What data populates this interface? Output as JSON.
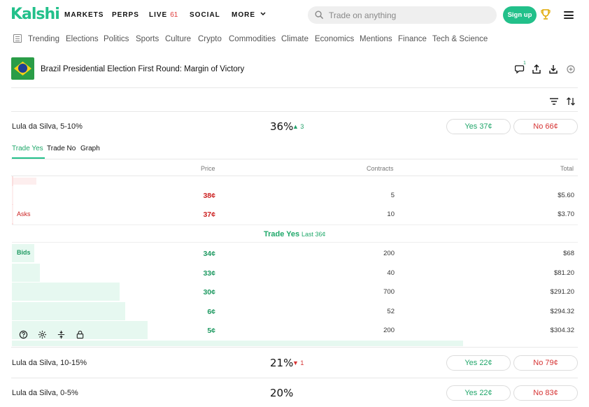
{
  "brand": {
    "logo": "Kalshi",
    "accent": "#22c08a"
  },
  "nav": {
    "markets": "MARKETS",
    "perps": "PERPS",
    "live": "LIVE",
    "live_count": "61",
    "social": "SOCIAL",
    "more": "MORE"
  },
  "search": {
    "placeholder": "Trade on anything"
  },
  "signup": "Sign up",
  "categories": [
    "Trending",
    "Elections",
    "Politics",
    "Sports",
    "Culture",
    "Crypto",
    "Commodities",
    "Climate",
    "Economics",
    "Mentions",
    "Finance",
    "Tech & Science"
  ],
  "market": {
    "title": "Brazil Presidential Election First Round: Margin of Victory",
    "comment_count": "1"
  },
  "outcomes": [
    {
      "name": "Lula da Silva, 5-10%",
      "pct": "36%",
      "change": "3",
      "direction": "up",
      "yes": "Yes 37¢",
      "no": "No 66¢"
    },
    {
      "name": "Lula da Silva, 10-15%",
      "pct": "21%",
      "change": "1",
      "direction": "down",
      "yes": "Yes 22¢",
      "no": "No 79¢"
    },
    {
      "name": "Lula da Silva, 0-5%",
      "pct": "20%",
      "change": "",
      "direction": "",
      "yes": "Yes 22¢",
      "no": "No 83¢"
    }
  ],
  "tabs": {
    "trade_yes": "Trade Yes",
    "trade_no": "Trade No",
    "graph": "Graph"
  },
  "orderbook": {
    "headers": {
      "price": "Price",
      "contracts": "Contracts",
      "total": "Total"
    },
    "asks_label": "Asks",
    "bids_label": "Bids",
    "asks": [
      {
        "price": "38¢",
        "contracts": "5",
        "total": "$5.60"
      },
      {
        "price": "37¢",
        "contracts": "10",
        "total": "$3.70"
      }
    ],
    "spread_label": "Trade Yes",
    "last_label": "Last 36¢",
    "bids": [
      {
        "price": "34¢",
        "contracts": "200",
        "total": "$68",
        "depth": 0.04
      },
      {
        "price": "33¢",
        "contracts": "40",
        "total": "$81.20",
        "depth": 0.05
      },
      {
        "price": "30¢",
        "contracts": "700",
        "total": "$291.20",
        "depth": 0.19
      },
      {
        "price": "6¢",
        "contracts": "52",
        "total": "$294.32",
        "depth": 0.2
      },
      {
        "price": "5¢",
        "contracts": "200",
        "total": "$304.32",
        "depth": 0.24
      }
    ]
  }
}
